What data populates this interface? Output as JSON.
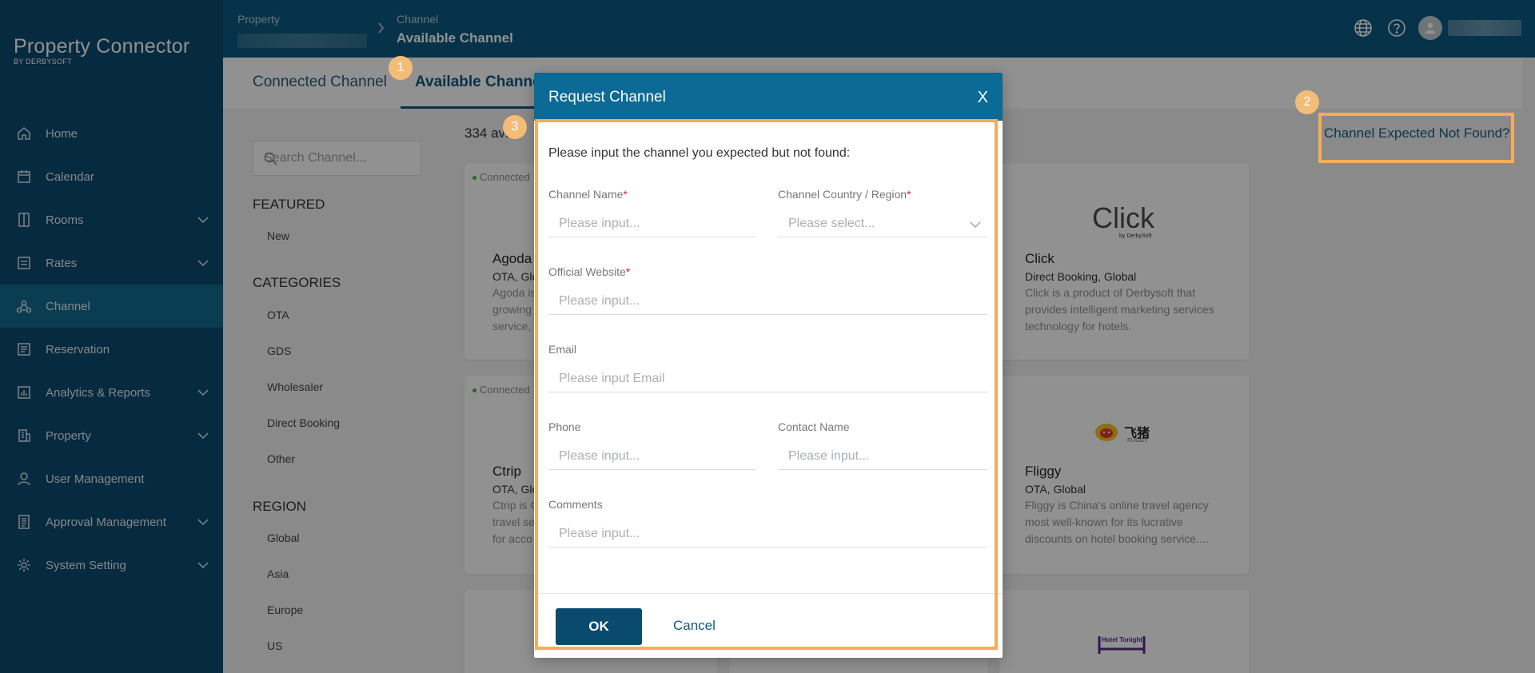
{
  "app": {
    "title": "Property Connector",
    "subtitle": "BY DERBYSOFT"
  },
  "sidebar": {
    "items": [
      {
        "label": "Home",
        "icon": "home-icon",
        "has_children": false
      },
      {
        "label": "Calendar",
        "icon": "calendar-icon",
        "has_children": false
      },
      {
        "label": "Rooms",
        "icon": "rooms-icon",
        "has_children": true
      },
      {
        "label": "Rates",
        "icon": "rates-icon",
        "has_children": true
      },
      {
        "label": "Channel",
        "icon": "channel-icon",
        "has_children": false,
        "active": true
      },
      {
        "label": "Reservation",
        "icon": "reservation-icon",
        "has_children": false
      },
      {
        "label": "Analytics & Reports",
        "icon": "analytics-icon",
        "has_children": true
      },
      {
        "label": "Property",
        "icon": "property-icon",
        "has_children": true
      },
      {
        "label": "User Management",
        "icon": "user-icon",
        "has_children": false
      },
      {
        "label": "Approval Management",
        "icon": "approval-icon",
        "has_children": true
      },
      {
        "label": "System Setting",
        "icon": "settings-icon",
        "has_children": true
      }
    ]
  },
  "header": {
    "breadcrumb_property": "Property",
    "breadcrumb_channel": "Channel",
    "breadcrumb_current": "Available Channel"
  },
  "tabs": {
    "connected": "Connected Channel",
    "available": "Available Channel"
  },
  "filters": {
    "search_placeholder": "Search Channel...",
    "featured_heading": "FEATURED",
    "featured_items": [
      "New"
    ],
    "categories_heading": "CATEGORIES",
    "categories": [
      "OTA",
      "GDS",
      "Wholesaler",
      "Direct Booking",
      "Other"
    ],
    "region_heading": "REGION",
    "regions": [
      "Global",
      "Asia",
      "Europe",
      "US"
    ]
  },
  "results": {
    "count_text": "334 ava"
  },
  "cards": [
    {
      "connected_label": "Connected",
      "name": "Agoda",
      "sub": "OTA, Glo",
      "desc": "Agoda is growing service,"
    },
    {
      "connected_label": "",
      "name": "Click",
      "sub": "Direct Booking, Global",
      "desc": "Click is a product of Derbysoft that provides intelligent marketing services technology for hotels.",
      "logo": "Click",
      "logo_by": "by DerbySoft"
    },
    {
      "connected_label": "Connected",
      "name": "Ctrip",
      "sub": "OTA, Glo",
      "desc": "Ctrip is C travel se for acco"
    },
    {
      "connected_label": "",
      "name": "Fliggy",
      "sub": "OTA, Global",
      "desc": "Fliggy is China's online travel agency most well-known for its lucrative discounts on hotel booking service....",
      "logo": "飞猪",
      "logo_sub": "FLIGGY"
    },
    {
      "logo": "Hotel Tonight"
    }
  ],
  "channel_not_found_link": "Channel Expected Not Found?",
  "modal": {
    "title": "Request Channel",
    "close": "X",
    "intro": "Please input the channel you expected but not found:",
    "fields": {
      "channel_name": {
        "label": "Channel Name",
        "placeholder": "Please input..."
      },
      "country": {
        "label": "Channel Country / Region",
        "placeholder": "Please select..."
      },
      "website": {
        "label": "Official Website",
        "placeholder": "Please input..."
      },
      "email": {
        "label": "Email",
        "placeholder": "Please input Email"
      },
      "phone": {
        "label": "Phone",
        "placeholder": "Please input..."
      },
      "contact": {
        "label": "Contact Name",
        "placeholder": "Please input..."
      },
      "comments": {
        "label": "Comments",
        "placeholder": "Please input..."
      }
    },
    "required_mark": "*",
    "ok": "OK",
    "cancel": "Cancel"
  },
  "annotations": {
    "badge1": "1",
    "badge2": "2",
    "badge3": "3"
  },
  "colors": {
    "sidebar": "#0b4a6f",
    "topbar": "#0b5a80",
    "highlight": "#f5ad5a",
    "modal_header": "#0b6a96"
  }
}
